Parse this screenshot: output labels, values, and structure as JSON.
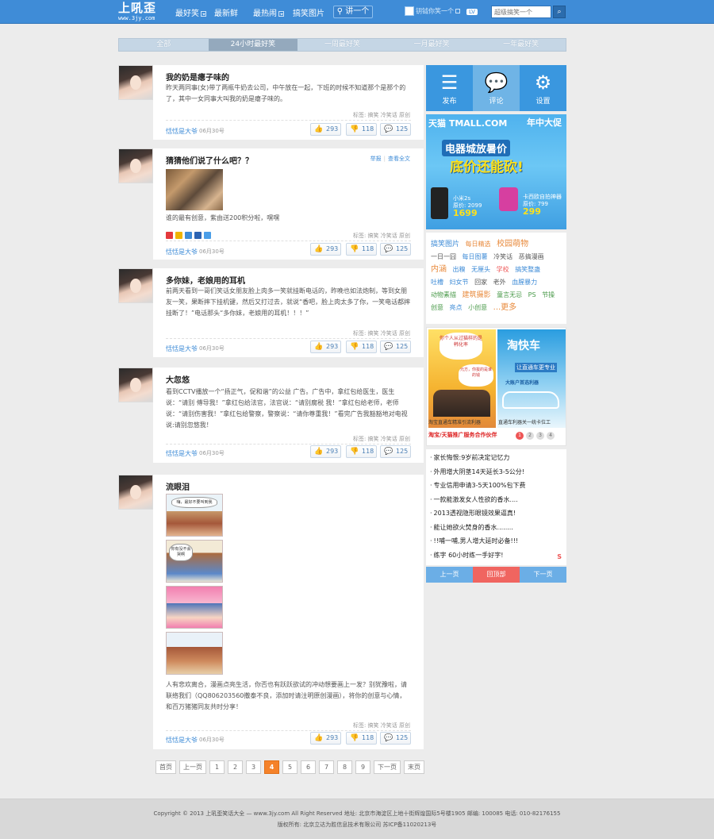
{
  "header": {
    "logo_main": "上吼歪",
    "logo_sub": "www.3jy.com",
    "nav": [
      "最好笑",
      "最新鲜",
      "最热闹",
      "搞笑图片"
    ],
    "tell_button": "讲一个",
    "user_text": "钥钺你笑一个",
    "level": "LV",
    "search_placeholder": "超级搞笑一个",
    "search_icon": "magnifier-icon"
  },
  "tabs": [
    "全部",
    "24小时最好笑",
    "一周最好笑",
    "一月最好笑",
    "一年最好笑"
  ],
  "posts": [
    {
      "title": "我的奶是瘪子味的",
      "body": "昨天两同事(女)带了两瓶牛奶去公司，中午放在一起，下班的时候不知道那个是那个的了，其中一女同事大叫我的奶是瘪子味的。",
      "tags": "标签: 搞笑 冷笑话 原创",
      "author": "恬恬是大爷",
      "date": "06月30号",
      "up": "293",
      "down": "118",
      "comments": "125"
    },
    {
      "title": "猜猜他们说了什么吧？？",
      "report": "举报",
      "view_all": "查看全文",
      "body": "谁的最有创意，紫由送200积分啦，嘿嘿",
      "tags": "标签: 搞笑 冷笑话 原创",
      "author": "恬恬是大爷",
      "date": "06月30号",
      "up": "293",
      "down": "118",
      "comments": "125"
    },
    {
      "title": "多你妹，老娘用的耳机",
      "body": "前两天看到一哥们笑话女朋友脸上肉多一笑就挂断电话的，昨晚也如法炮制，等到女朋友一笑，果断摔下挂机键，然后又打过去，就说“香吧，脸上肉太多了你，一笑电话都摔挂断了！”电话那头“多你妹，老娘用的耳机！！！”",
      "tags": "标签: 搞笑 冷笑话 原创",
      "author": "恬恬是大爷",
      "date": "06月30号",
      "up": "293",
      "down": "118",
      "comments": "125"
    },
    {
      "title": "大忽悠",
      "body": "看到CCTV播放一个“扬正气，促和谐”的公益 广告。广告中，拿红包给医生，医生说：“请别 傅导我！”拿红包给法官，法官说：“请别腐税 我！”拿红包给老师，老师说：“请别伤害我！”拿红包给警察，警察说：“请你尊重我！”看完广告我豁豁地对电视说:请别忽悠我！",
      "tags": "标签: 搞笑 冷笑话 原创",
      "author": "恬恬是大爷",
      "date": "06月30号",
      "up": "293",
      "down": "118",
      "comments": "125"
    },
    {
      "title": "流眼泪",
      "panel1": "嗨，最好不要叫到我",
      "panel2": "你有没不会哭啊",
      "body": "人有悲欢离合，漫画点亮生活，你否也有跃跃欲试的冲动想要画上一发？别犹豫啦，请联络我们（QQ806203560撒泰不良，添加时请注明原创漫画），将你的创意与心情，和百万猪猪同友共时分享！",
      "tags": "标签: 搞笑 冷笑话 原创",
      "author": "恬恬是大爷",
      "date": "06月30号",
      "up": "293",
      "down": "118",
      "comments": "125"
    }
  ],
  "pager": [
    "首页",
    "上一页",
    "1",
    "2",
    "3",
    "4",
    "5",
    "6",
    "7",
    "8",
    "9",
    "下一页",
    "末页"
  ],
  "pager_current": "4",
  "sidebar": {
    "actions": [
      {
        "label": "发布",
        "icon": "compose-list-icon"
      },
      {
        "label": "评论",
        "icon": "comment-bubble-icon"
      },
      {
        "label": "设置",
        "icon": "gear-icon"
      }
    ],
    "ad1": {
      "brand": "天猫 TMALL.COM",
      "tag": "年中大促",
      "headline1": "电器城放暑价",
      "headline2": "底价还能砍!",
      "p1_name": "小米2s",
      "p1_old": "原价: 2099",
      "p1_price": "1699",
      "p2_name": "卡西欧自拍神器",
      "p2_old": "原价: 799",
      "p2_price": "299"
    },
    "links": [
      [
        {
          "t": "搞笑图片",
          "c": "#3f8cd7"
        },
        {
          "t": "每日精选",
          "c": "#e88a3c"
        },
        {
          "t": "校园萌物",
          "c": "#e88a3c"
        }
      ],
      [
        {
          "t": "一日一囧",
          "c": "#555"
        },
        {
          "t": "每日图薯",
          "c": "#3f8cd7"
        },
        {
          "t": "冷笑话",
          "c": "#555"
        },
        {
          "t": "恶搞漫画",
          "c": "#555"
        }
      ],
      [
        {
          "t": "内涵",
          "c": "#e88a3c"
        },
        {
          "t": "出糗",
          "c": "#3f8cd7"
        },
        {
          "t": "无厘头",
          "c": "#3f8cd7"
        },
        {
          "t": "学校",
          "c": "#e55"
        },
        {
          "t": "搞笑整蛊",
          "c": "#3f8cd7"
        }
      ],
      [
        {
          "t": "吐槽",
          "c": "#3f8cd7"
        },
        {
          "t": "妇女节",
          "c": "#3f8cd7"
        },
        {
          "t": "回家",
          "c": "#555"
        },
        {
          "t": "老外",
          "c": "#555"
        },
        {
          "t": "血腥暴力",
          "c": "#3f8cd7"
        }
      ],
      [
        {
          "t": "动物素描",
          "c": "#4a9a4a"
        },
        {
          "t": "建筑摄影",
          "c": "#e88a3c"
        },
        {
          "t": "童言无忌",
          "c": "#4a9a4a"
        },
        {
          "t": "PS",
          "c": "#4a9a4a"
        },
        {
          "t": "节操",
          "c": "#4a9a4a"
        }
      ],
      [
        {
          "t": "创意",
          "c": "#4a9a4a"
        },
        {
          "t": "亮点",
          "c": "#3f8cd7"
        },
        {
          "t": "小创意",
          "c": "#4a9a4a"
        },
        {
          "t": "...更多",
          "c": "#e88a3c"
        }
      ]
    ],
    "ad2": {
      "bubble": "你个人从过猫样的是韩化率",
      "bubble2": "元方，你拔的是谁的钱",
      "right_title": "淘快车",
      "right_sub": "让直通车更专业",
      "right_sub2": "大账户首选利器",
      "cap1": "淘宝直通车精准引流利器",
      "cap2": "直通车利器关一统卡位工",
      "bottom": "淘宝/天猫推广服务合作伙伴",
      "dots": [
        "1",
        "2",
        "3",
        "4"
      ]
    },
    "hot_list": [
      "家长悔恨:9岁前决定记忆力",
      "外用增大阴茎14天延长3-5公分!",
      "专业信用申请3-5天100%包下费",
      "一款能激发女人性欲的香水....",
      "2013透视隐形眼镜效果逼真!",
      "能让她欲火焚身的香水........",
      "!!哺一哺,男人增大延时必备!!!",
      "练字 60小时练一手好字!"
    ],
    "hot_sign": "S",
    "pager": [
      "上一页",
      "回顶部",
      "下一页"
    ]
  },
  "footer": {
    "line1": "Copyright © 2013 上吼歪笑话大全 — www.3jy.com All Right Reserved  地址: 北京市海淀区上地十街辉煌国际5号楼1905 邮编: 100085 电话: 010-82176155",
    "line2": "版权所有: 北京立达为胜信息技术有限公司 苏ICP备11020213号"
  }
}
